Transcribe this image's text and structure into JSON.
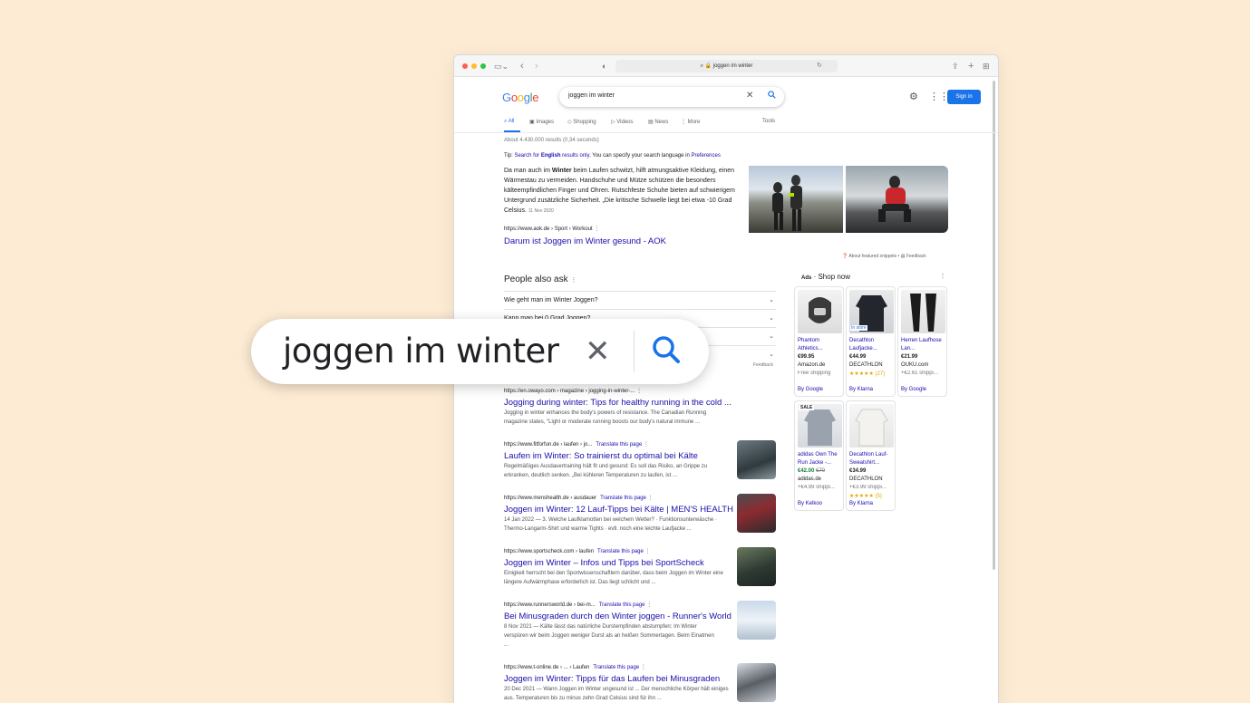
{
  "browser": {
    "url": "joggen im winter",
    "colors": {
      "red": "#ff5f57",
      "yellow": "#febc2e",
      "green": "#28c840"
    }
  },
  "google": {
    "logo": "Google",
    "query": "joggen im winter",
    "sign_in": "Sign in",
    "tabs": [
      "All",
      "Images",
      "Shopping",
      "Videos",
      "News",
      "More"
    ],
    "tools": "Tools",
    "result_stats": "About 4.430.000 results (0,34 seconds)",
    "tip": {
      "prefix": "Tip: ",
      "link1": "Search for ",
      "bold": "English",
      "link2": " results only",
      "mid": ". You can specify your search language in ",
      "pref": "Preferences"
    }
  },
  "featured": {
    "text_pre": "Da man auch im ",
    "bold": "Winter",
    "text_post": " beim Laufen schwitzt, hilft atmungsaktive Kleidung, einen Wärmestau zu vermeiden. Handschuhe und Mütze schützen die besonders kälteempfindlichen Finger und Ohren. Rutschfeste Schuhe bieten auf schwierigem Untergrund zusätzliche Sicherheit. „Die kritische Schwelle liegt bei etwa -10 Grad Celsius.",
    "date": "11 Nov 2020",
    "url": "https://www.aok.de › Sport › Workout",
    "title": "Darum ist Joggen im Winter gesund - AOK",
    "about": "About featured snippets",
    "feedback": "Feedback"
  },
  "paa": {
    "title": "People also ask",
    "questions": [
      "Wie geht man im Winter Joggen?",
      "Kann man bei 0 Grad Joggen?",
      "",
      ""
    ],
    "feedback": "Feedback"
  },
  "results": [
    {
      "url": "https://en.owayo.com › magazine › jogging-in-winter-...",
      "translate": "",
      "title": "Jogging during winter: Tips for healthy running in the cold ...",
      "desc": "Jogging in winter enhances the body's powers of resistance. The Canadian Running magazine states, \"Light or moderate running boosts our body's natural immune ..."
    },
    {
      "url": "https://www.fitforfun.de › laufen › jo...",
      "translate": "Translate this page",
      "title": "Laufen im Winter: So trainierst du optimal bei Kälte",
      "desc": "Regelmäßiges Ausdauertraining hält fit und gesund: Es soll das Risiko, an Grippe zu erkranken, deutlich senken. „Bei kühleren Temperaturen zu laufen, ist ..."
    },
    {
      "url": "https://www.menshealth.de › ausdauer",
      "translate": "Translate this page",
      "title": "Joggen im Winter: 12 Lauf-Tipps bei Kälte | MEN'S HEALTH",
      "desc": "14 Jan 2022 — 3. Welche Laufklamotten bei welchem Wetter? · Funktionsunterwäsche · Thermo-Langarm-Shirt und warme Tights · evtl. noch eine leichte Laufjacke ..."
    },
    {
      "url": "https://www.sportscheck.com › laufen",
      "translate": "Translate this page",
      "title": "Joggen im Winter – Infos und Tipps bei SportScheck",
      "desc": "Einigkeit herrscht bei den Sportwissenschaftlern darüber, dass beim Joggen im Winter eine längere Aufwärmphase erforderlich ist. Das liegt schlicht und ..."
    },
    {
      "url": "https://www.runnersworld.de › bei-m...",
      "translate": "Translate this page",
      "title": "Bei Minusgraden durch den Winter joggen - Runner's World",
      "desc": "8 Nov 2021 — Kälte lässt das natürliche Durstempfinden abstumpfen: Im Winter verspüren wir beim Joggen weniger Durst als an heißen Sommertagen. Beim Einatmen ..."
    },
    {
      "url": "https://www.t-online.de › ... › Laufen",
      "translate": "Translate this page",
      "title": "Joggen im Winter: Tipps für das Laufen bei Minusgraden",
      "desc": "20 Dec 2021 — Wann Joggen im Winter ungesund ist ... Der menschliche Körper hält einiges aus. Temperaturen bis zu minus zehn Grad Celsius sind für ihn ..."
    }
  ],
  "shop": {
    "ads": "Ads",
    "title": " · Shop now",
    "items": [
      {
        "name": "Phantom Athletics...",
        "price": "€99.95",
        "old": "",
        "store": "Amazon.de",
        "ship": "Free shipping",
        "rating": "",
        "by": "By Google",
        "badge": ""
      },
      {
        "name": "Decathlon Laufjacke...",
        "price": "€44.99",
        "old": "",
        "store": "DECATHLON",
        "ship": "",
        "rating": "★★★★★ (27)",
        "by": "By Klarna",
        "badge": "In store"
      },
      {
        "name": "Herren Laufhose Lan...",
        "price": "€21.99",
        "old": "",
        "store": "OUKU.com",
        "ship": "+€2.61 shippi...",
        "rating": "",
        "by": "By Google",
        "badge": ""
      },
      {
        "name": "adidas Own The Run Jacke -...",
        "price": "€42.00",
        "old": "€70",
        "store": "adidas.de",
        "ship": "+€4.99 shippi...",
        "rating": "",
        "by": "By Kelkoo",
        "badge": "SALE"
      },
      {
        "name": "Decathlon Lauf-Sweatshirt...",
        "price": "€34.99",
        "old": "",
        "store": "DECATHLON",
        "ship": "+€3.99 shippi...",
        "rating": "★★★★★ (5)",
        "by": "By Klarna",
        "badge": ""
      }
    ]
  },
  "zoom": {
    "query": "joggen im winter"
  }
}
